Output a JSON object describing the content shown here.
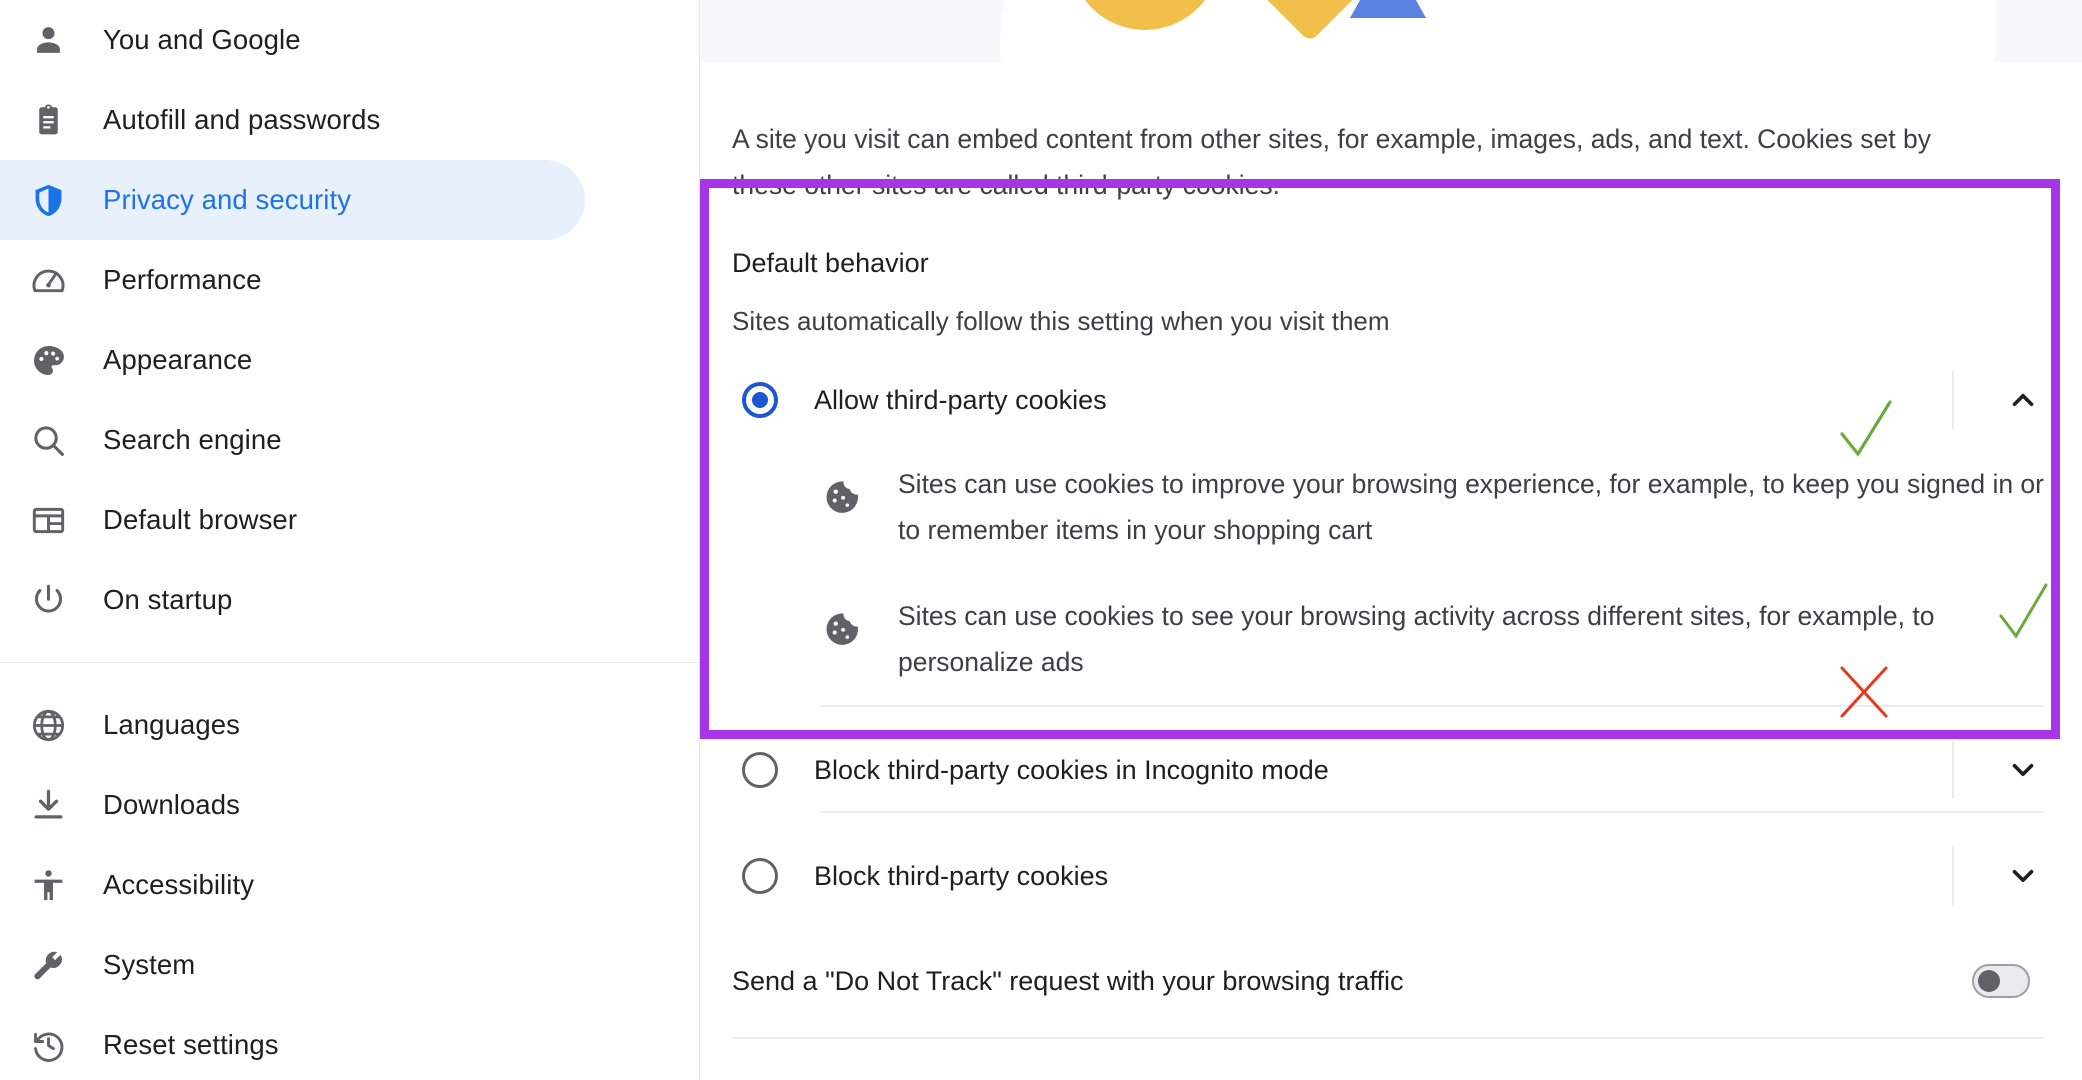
{
  "sidebar": {
    "items": [
      {
        "label": "You and Google",
        "icon": "person-icon",
        "active": false
      },
      {
        "label": "Autofill and passwords",
        "icon": "clipboard-icon",
        "active": false
      },
      {
        "label": "Privacy and security",
        "icon": "shield-icon",
        "active": true
      },
      {
        "label": "Performance",
        "icon": "speedometer-icon",
        "active": false
      },
      {
        "label": "Appearance",
        "icon": "palette-icon",
        "active": false
      },
      {
        "label": "Search engine",
        "icon": "search-icon",
        "active": false
      },
      {
        "label": "Default browser",
        "icon": "browser-window-icon",
        "active": false
      },
      {
        "label": "On startup",
        "icon": "power-icon",
        "active": false
      }
    ],
    "items_secondary": [
      {
        "label": "Languages",
        "icon": "globe-icon",
        "active": false
      },
      {
        "label": "Downloads",
        "icon": "download-icon",
        "active": false
      },
      {
        "label": "Accessibility",
        "icon": "accessibility-icon",
        "active": false
      },
      {
        "label": "System",
        "icon": "wrench-icon",
        "active": false
      },
      {
        "label": "Reset settings",
        "icon": "history-restore-icon",
        "active": false
      }
    ]
  },
  "main": {
    "intro": "A site you visit can embed content from other sites, for example, images, ads, and text. Cookies set by these other sites are called third-party cookies.",
    "section": {
      "title": "Default behavior",
      "subtitle": "Sites automatically follow this setting when you visit them",
      "options": [
        {
          "label": "Allow third-party cookies",
          "selected": true,
          "expanded": true,
          "annotation": "green-check",
          "chevron": "chevron-up-icon",
          "details": [
            "Sites can use cookies to improve your browsing experience, for example, to keep you signed in or to remember items in your shopping cart",
            "Sites can use cookies to see your browsing activity across different sites, for example, to personalize ads"
          ]
        },
        {
          "label": "Block third-party cookies in Incognito mode",
          "selected": false,
          "expanded": false,
          "annotation": "green-check",
          "chevron": "chevron-down-icon",
          "details": []
        },
        {
          "label": "Block third-party cookies",
          "selected": false,
          "expanded": false,
          "annotation": "red-cross",
          "chevron": "chevron-down-icon",
          "details": []
        }
      ]
    },
    "do_not_track": {
      "label": "Send a \"Do Not Track\" request with your browsing traffic",
      "enabled": false
    }
  },
  "colors": {
    "accent_blue": "#1a73e8",
    "radio_blue": "#1a57d0",
    "highlight_purple": "#a734e8",
    "annotation_green": "#6aaa3c",
    "annotation_red": "#e5391e",
    "hero_yellow": "#f1c04a",
    "hero_blue": "#5a82e0",
    "active_bg": "#e8f0fe"
  }
}
